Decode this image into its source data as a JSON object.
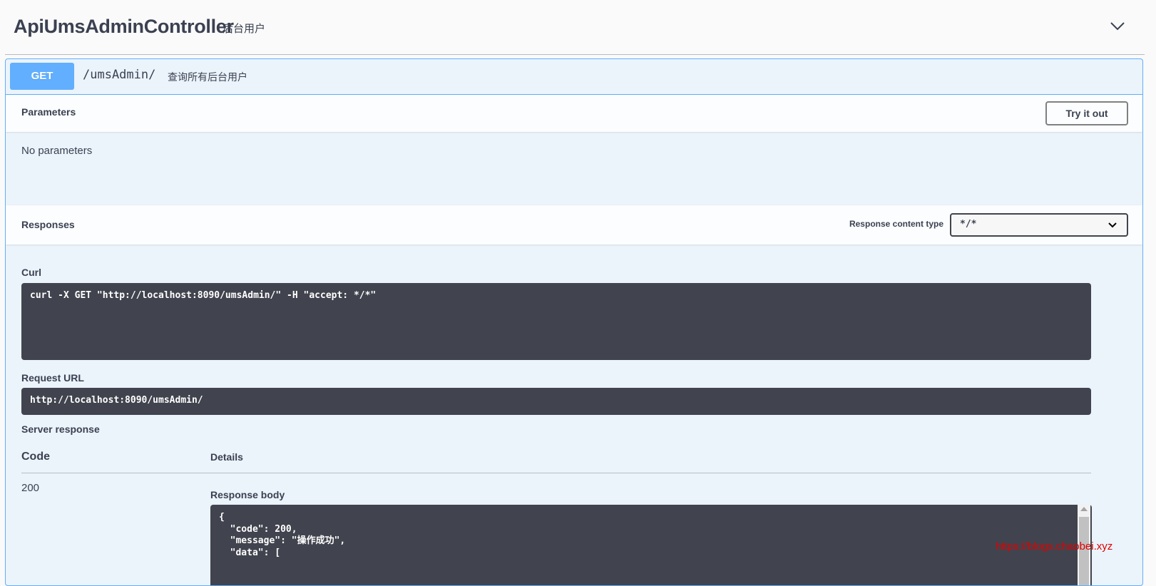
{
  "tag": {
    "title": "ApiUmsAdminController",
    "description": "后台用户",
    "toggle_icon": "chevron-down-icon"
  },
  "operation": {
    "method": "GET",
    "path": "/umsAdmin/",
    "summary": "查询所有后台用户",
    "method_color": "#61affe"
  },
  "parameters": {
    "title": "Parameters",
    "try_button": "Try it out",
    "empty_text": "No parameters"
  },
  "responses": {
    "title": "Responses",
    "content_type_label": "Response content type",
    "content_type_value": "*/*",
    "curl_label": "Curl",
    "curl_command": "curl -X GET \"http://localhost:8090/umsAdmin/\" -H \"accept: */*\"",
    "request_url_label": "Request URL",
    "request_url": "http://localhost:8090/umsAdmin/",
    "server_response_label": "Server response",
    "col_code": "Code",
    "col_details": "Details",
    "status_code": "200",
    "response_body_label": "Response body",
    "response_body": "{\n  \"code\": 200,\n  \"message\": \"操作成功\",\n  \"data\": ["
  },
  "watermark": "https://blogs.chaobei.xyz"
}
